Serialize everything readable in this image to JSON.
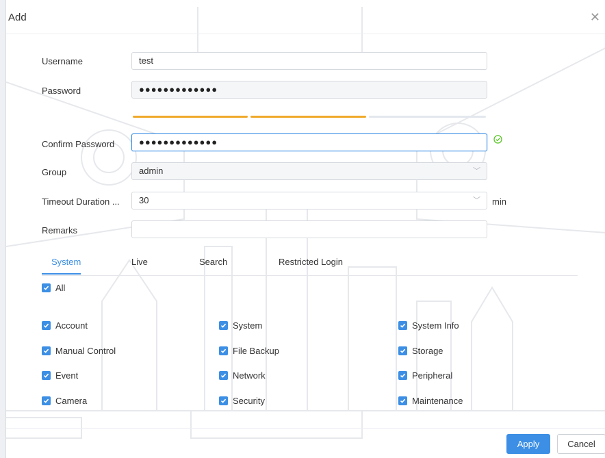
{
  "dialog": {
    "title": "Add"
  },
  "form": {
    "username": {
      "label": "Username",
      "value": "test"
    },
    "password": {
      "label": "Password",
      "value": "●●●●●●●●●●●●●",
      "strength_level": 0.67
    },
    "confirm_password": {
      "label": "Confirm Password",
      "value": "●●●●●●●●●●●●●"
    },
    "group": {
      "label": "Group",
      "value": "admin"
    },
    "timeout": {
      "label": "Timeout Duration ...",
      "value": "30",
      "unit": "min"
    },
    "remarks": {
      "label": "Remarks",
      "value": ""
    }
  },
  "tabs": [
    {
      "label": "System",
      "active": true
    },
    {
      "label": "Live",
      "active": false
    },
    {
      "label": "Search",
      "active": false
    },
    {
      "label": "Restricted Login",
      "active": false
    }
  ],
  "permissions": {
    "all": {
      "label": "All",
      "checked": true
    },
    "items": [
      {
        "label": "Account",
        "checked": true
      },
      {
        "label": "System",
        "checked": true
      },
      {
        "label": "System Info",
        "checked": true
      },
      {
        "label": "Manual Control",
        "checked": true
      },
      {
        "label": "File Backup",
        "checked": true
      },
      {
        "label": "Storage",
        "checked": true
      },
      {
        "label": "Event",
        "checked": true
      },
      {
        "label": "Network",
        "checked": true
      },
      {
        "label": "Peripheral",
        "checked": true
      },
      {
        "label": "Camera",
        "checked": true
      },
      {
        "label": "Security",
        "checked": true
      },
      {
        "label": "Maintenance",
        "checked": true
      }
    ]
  },
  "buttons": {
    "apply": "Apply",
    "cancel": "Cancel"
  },
  "colors": {
    "accent": "#3c8fe4",
    "strength": "#f0a92a",
    "success": "#52c41a"
  },
  "icons": {
    "close": "close-icon",
    "check": "check-circle-icon",
    "dropdown": "chevron-down-icon",
    "checkbox": "checkmark-icon"
  }
}
